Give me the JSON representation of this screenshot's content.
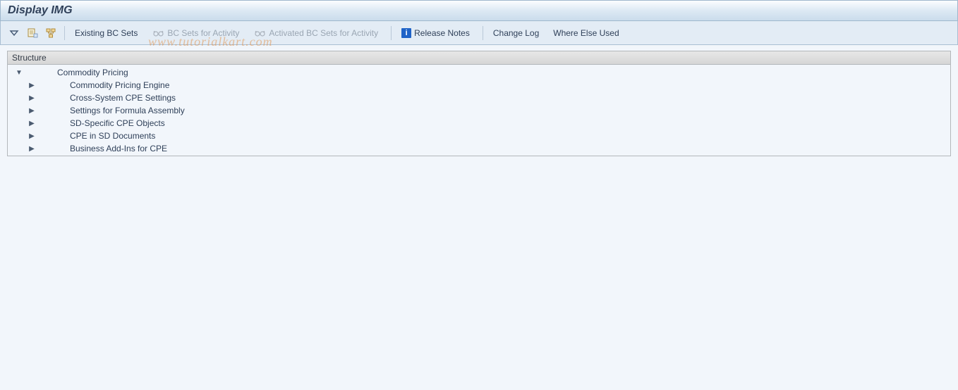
{
  "window": {
    "title": "Display IMG"
  },
  "toolbar": {
    "existing_bc_sets": "Existing BC Sets",
    "bc_sets_for_activity": "BC Sets for Activity",
    "activated_bc_sets_for_activity": "Activated BC Sets for Activity",
    "release_notes": "Release Notes",
    "change_log": "Change Log",
    "where_else_used": "Where Else Used"
  },
  "content": {
    "structure_header": "Structure"
  },
  "tree": {
    "root": {
      "label": "Commodity Pricing",
      "expanded": true
    },
    "items": [
      {
        "label": "Commodity Pricing Engine",
        "expanded": false
      },
      {
        "label": "Cross-System CPE Settings",
        "expanded": false
      },
      {
        "label": "Settings for Formula Assembly",
        "expanded": false
      },
      {
        "label": "SD-Specific CPE Objects",
        "expanded": false
      },
      {
        "label": "CPE in SD Documents",
        "expanded": false
      },
      {
        "label": "Business Add-Ins for CPE",
        "expanded": false
      }
    ]
  },
  "watermark": "www.tutorialkart.com"
}
